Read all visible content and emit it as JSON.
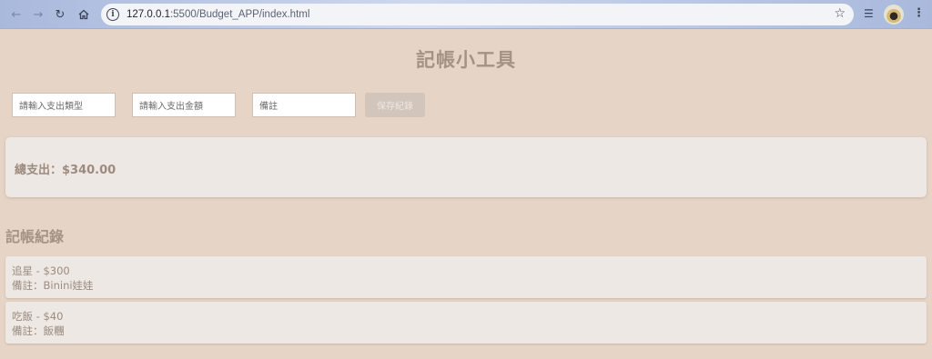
{
  "browser": {
    "url_host": "127.0.0.1",
    "url_path": ":5500/Budget_APP/index.html"
  },
  "app": {
    "title": "記帳小工具",
    "form": {
      "type_placeholder": "請輸入支出類型",
      "amount_placeholder": "請輸入支出金額",
      "note_placeholder": "備註",
      "save_label": "保存紀錄"
    },
    "total_text": "總支出：$340.00",
    "records_title": "記帳紀錄",
    "records": [
      {
        "line1": "追星 - $300",
        "line2": "備註：Binini娃娃"
      },
      {
        "line1": "吃飯 - $40",
        "line2": "備註：飯糰"
      }
    ]
  }
}
